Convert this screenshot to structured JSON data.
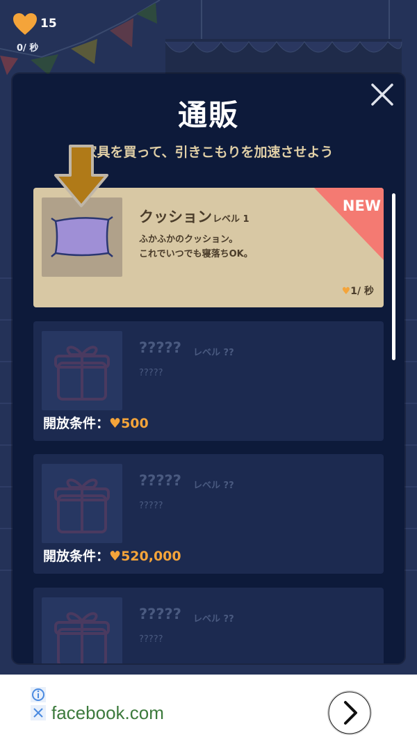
{
  "hud": {
    "heart_count": "15",
    "rate": "0/ 秒",
    "heart_color": "#f4a43a"
  },
  "modal": {
    "title": "通販",
    "subtitle": "家具を買って、引きこもりを加速させよう",
    "close_icon": "close-icon"
  },
  "items": [
    {
      "name": "クッション",
      "level": "レベル 1",
      "description": "ふかふかのクッション。\nこれでいつでも寝落ちOK。",
      "rate_value": "1/ 秒",
      "badge": "NEW",
      "unlocked": true
    },
    {
      "name": "?????",
      "level": "レベル ??",
      "description": "?????",
      "unlock_label": "開放条件：",
      "unlock_cost": "500",
      "unlocked": false
    },
    {
      "name": "?????",
      "level": "レベル ??",
      "description": "?????",
      "unlock_label": "開放条件：",
      "unlock_cost": "520,000",
      "unlocked": false
    },
    {
      "name": "?????",
      "level": "レベル ??",
      "description": "?????",
      "unlocked": false
    }
  ],
  "ad": {
    "text": "facebook.com",
    "info_icon": "info-icon",
    "close_icon": "ad-close-icon",
    "next_icon": "chevron-right-icon"
  },
  "colors": {
    "accent": "#f4a43a",
    "new_badge": "#f47a72",
    "card_unlocked": "#d8c8a4",
    "card_locked": "#1c2a50",
    "modal_bg": "#0d1a3a"
  }
}
